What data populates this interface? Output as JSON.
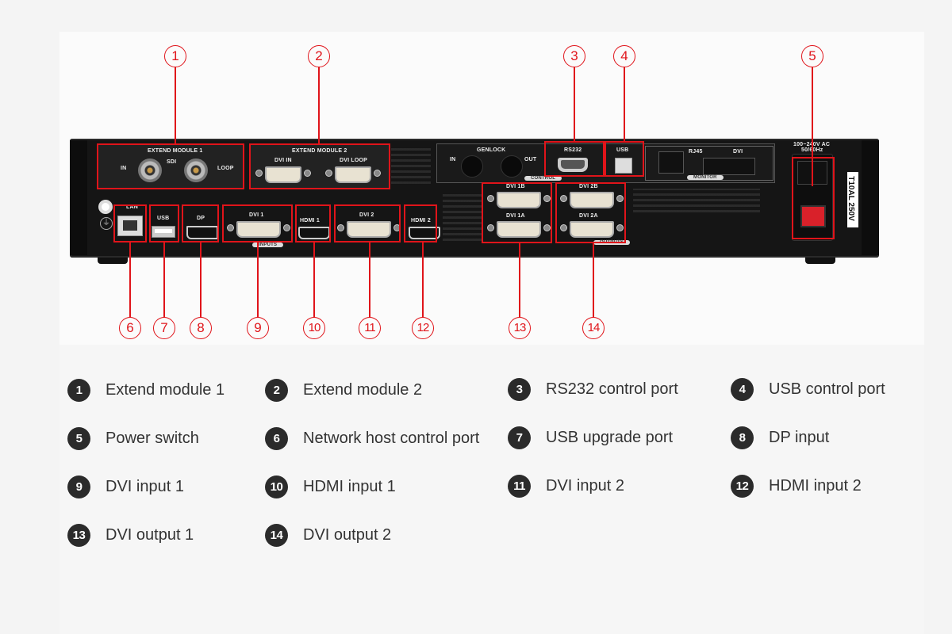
{
  "device": {
    "panel_labels": {
      "extend_module_1": "EXTEND MODULE 1",
      "sdi_in": "IN",
      "sdi": "SDI",
      "sdi_loop": "LOOP",
      "extend_module_2": "EXTEND MODULE 2",
      "dvi_in": "DVI IN",
      "dvi_loop": "DVI LOOP",
      "genlock": "GENLOCK",
      "genlock_in": "IN",
      "genlock_out": "OUT",
      "rs232": "RS232",
      "usb_control": "USB",
      "control": "CONTROL",
      "rj45": "RJ45",
      "monitor_dvi": "DVI",
      "monitor": "MONITOR",
      "lan": "LAN",
      "usb": "USB",
      "dp": "DP",
      "dvi_1": "DVI 1",
      "hdmi_1": "HDMI 1",
      "dvi_2": "DVI 2",
      "hdmi_2": "HDMI 2",
      "inputs": "INPUTS",
      "dvi_1b": "DVI 1B",
      "dvi_1a": "DVI 1A",
      "dvi_2b": "DVI 2B",
      "dvi_2a": "DVI 2A",
      "outputs": "OUTPUTS",
      "power_rating": "100~240V  AC",
      "power_freq": "50/60Hz",
      "fuse": "T10AL 250V"
    },
    "accent_color": "#e0141a"
  },
  "callouts": [
    "1",
    "2",
    "3",
    "4",
    "5",
    "6",
    "7",
    "8",
    "9",
    "10",
    "11",
    "12",
    "13",
    "14"
  ],
  "legend": [
    {
      "num": "1",
      "label": "Extend module 1"
    },
    {
      "num": "2",
      "label": "Extend module 2"
    },
    {
      "num": "3",
      "label": "RS232 control port"
    },
    {
      "num": "4",
      "label": "USB control port"
    },
    {
      "num": "5",
      "label": "Power switch"
    },
    {
      "num": "6",
      "label": "Network host control port"
    },
    {
      "num": "7",
      "label": "USB upgrade port"
    },
    {
      "num": "8",
      "label": "DP input"
    },
    {
      "num": "9",
      "label": "DVI input 1"
    },
    {
      "num": "10",
      "label": "HDMI input 1"
    },
    {
      "num": "11",
      "label": "DVI input 2"
    },
    {
      "num": "12",
      "label": "HDMI input 2"
    },
    {
      "num": "13",
      "label": "DVI output 1"
    },
    {
      "num": "14",
      "label": "DVI output 2"
    }
  ]
}
